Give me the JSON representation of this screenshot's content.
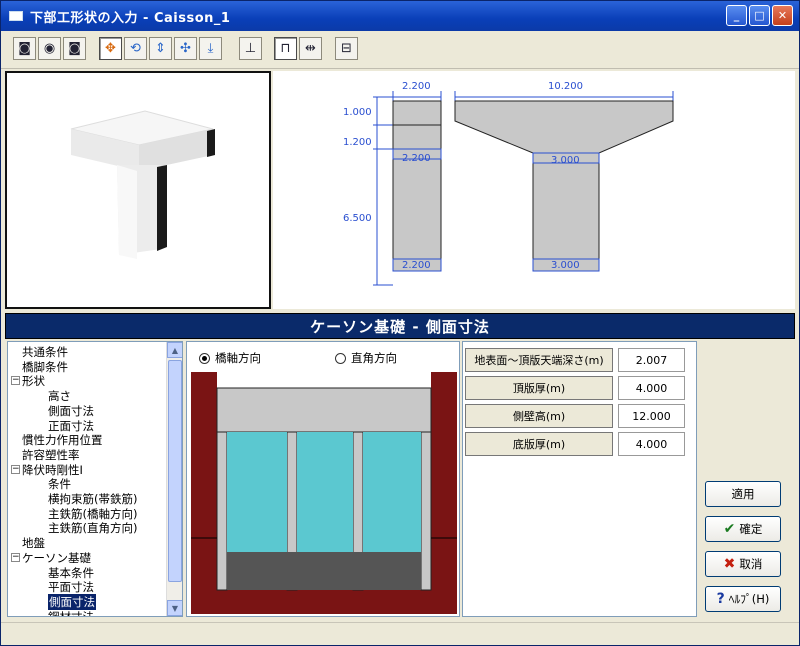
{
  "window": {
    "title": "下部工形状の入力 - Caisson_1",
    "min": "_",
    "max": "□",
    "close": "✕"
  },
  "toolbar": [
    {
      "icon": "camera-icon",
      "glyph": "◙"
    },
    {
      "icon": "eye-icon",
      "glyph": "◉"
    },
    {
      "icon": "video-icon",
      "glyph": "◙"
    },
    {
      "icon": "move-icon",
      "glyph": "✥"
    },
    {
      "icon": "rotate-icon",
      "glyph": "⟲"
    },
    {
      "icon": "vertical-move-icon",
      "glyph": "⇕"
    },
    {
      "icon": "pan-icon",
      "glyph": "✣"
    },
    {
      "icon": "lower-icon",
      "glyph": "⤓"
    },
    {
      "icon": "front-view-icon",
      "glyph": "⊥"
    },
    {
      "icon": "section-icon",
      "glyph": "⊓"
    },
    {
      "icon": "dimension-icon",
      "glyph": "⇹"
    },
    {
      "icon": "settings-icon",
      "glyph": "⊟"
    }
  ],
  "drawing": {
    "left_dims": [
      "1.000",
      "1.200",
      "6.500"
    ],
    "top_dims": [
      "2.200",
      "10.200"
    ],
    "side_labels": [
      "2.200",
      "2.200"
    ],
    "front_labels": [
      "3.000",
      "3.000"
    ]
  },
  "section_header": "ケーソン基礎 - 側面寸法",
  "tree": [
    {
      "label": "共通条件",
      "level": 1
    },
    {
      "label": "橋脚条件",
      "level": 1
    },
    {
      "label": "形状",
      "level": 0,
      "expander": "−"
    },
    {
      "label": "高さ",
      "level": 2
    },
    {
      "label": "側面寸法",
      "level": 2
    },
    {
      "label": "正面寸法",
      "level": 2
    },
    {
      "label": "慣性力作用位置",
      "level": 1
    },
    {
      "label": "許容塑性率",
      "level": 1
    },
    {
      "label": "降伏時剛性I",
      "level": 0,
      "expander": "−"
    },
    {
      "label": "条件",
      "level": 2
    },
    {
      "label": "横拘束筋(帯鉄筋)",
      "level": 2
    },
    {
      "label": "主鉄筋(橋軸方向)",
      "level": 2
    },
    {
      "label": "主鉄筋(直角方向)",
      "level": 2
    },
    {
      "label": "地盤",
      "level": 1
    },
    {
      "label": "ケーソン基礎",
      "level": 0,
      "expander": "−"
    },
    {
      "label": "基本条件",
      "level": 2
    },
    {
      "label": "平面寸法",
      "level": 2
    },
    {
      "label": "側面寸法",
      "level": 2,
      "selected": true
    },
    {
      "label": "鋼材寸法",
      "level": 2
    }
  ],
  "radios": {
    "bridge_axis": "橋軸方向",
    "perpendicular": "直角方向"
  },
  "params": [
    {
      "label": "地表面～頂版天端深さ(m)",
      "value": "2.007"
    },
    {
      "label": "頂版厚(m)",
      "value": "4.000"
    },
    {
      "label": "側壁高(m)",
      "value": "12.000"
    },
    {
      "label": "底版厚(m)",
      "value": "4.000"
    }
  ],
  "buttons": {
    "apply": "適用",
    "ok": "確定",
    "cancel": "取消",
    "help": "ﾍﾙﾌﾟ(H)"
  }
}
